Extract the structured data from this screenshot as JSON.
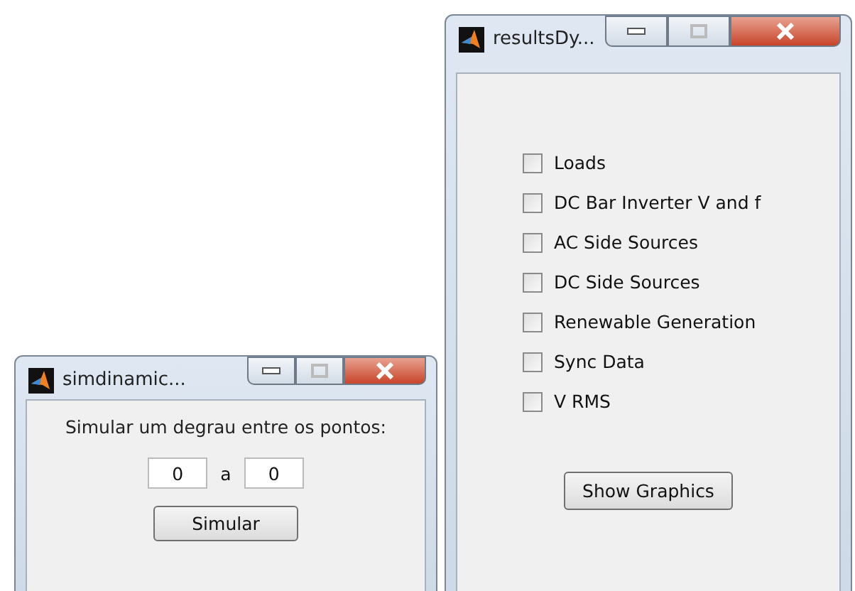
{
  "results_window": {
    "title": "resultsDy...",
    "options": [
      {
        "label": "Loads",
        "checked": false
      },
      {
        "label": "DC Bar Inverter V and f",
        "checked": false
      },
      {
        "label": "AC Side Sources",
        "checked": false
      },
      {
        "label": "DC Side Sources",
        "checked": false
      },
      {
        "label": "Renewable Generation",
        "checked": false
      },
      {
        "label": "Sync Data",
        "checked": false
      },
      {
        "label": "V RMS",
        "checked": false
      }
    ],
    "button": "Show Graphics"
  },
  "simulation_window": {
    "title": "simdinamic...",
    "prompt": "Simular um degrau entre os pontos:",
    "from_value": "0",
    "separator": "a",
    "to_value": "0",
    "button": "Simular"
  }
}
